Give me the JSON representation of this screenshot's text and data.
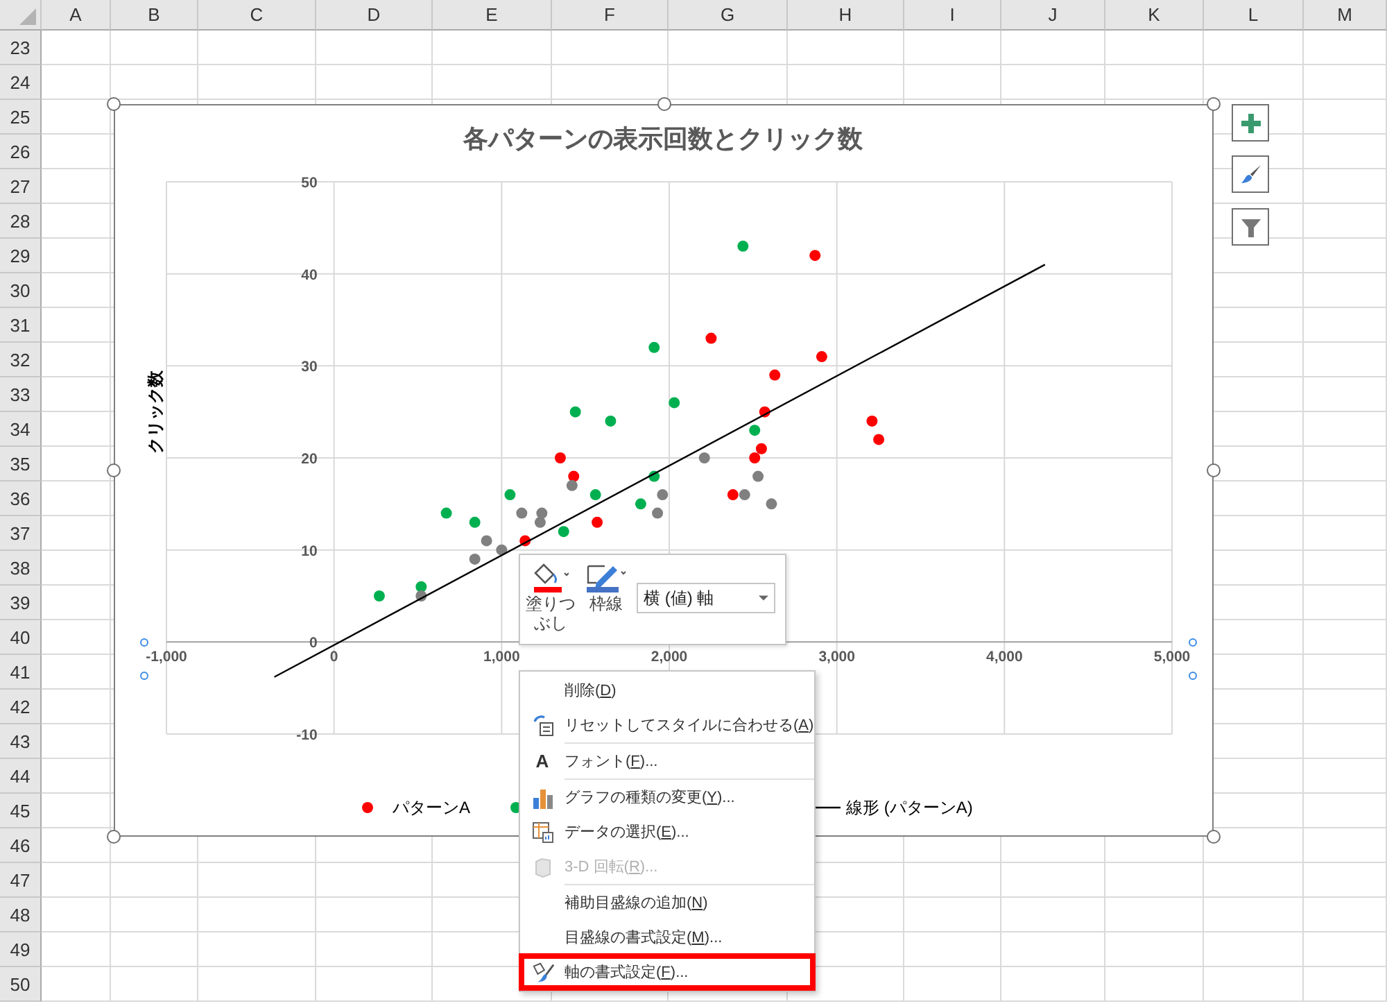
{
  "sheet": {
    "columns": [
      "A",
      "B",
      "C",
      "D",
      "E",
      "F",
      "G",
      "H",
      "I",
      "J",
      "K",
      "L",
      "M"
    ],
    "rows": [
      "23",
      "24",
      "25",
      "26",
      "27",
      "28",
      "29",
      "30",
      "31",
      "32",
      "33",
      "34",
      "35",
      "36",
      "37",
      "38",
      "39",
      "40",
      "41",
      "42",
      "43",
      "44",
      "45",
      "46",
      "47",
      "48",
      "49",
      "50"
    ]
  },
  "chart": {
    "title": "各パターンの表示回数とクリック数",
    "chart_data": {
      "type": "scatter",
      "ylabel": "クリック数",
      "xlim": [
        -1000,
        5000
      ],
      "ylim": [
        -10,
        50
      ],
      "xticks": [
        {
          "value": -1000,
          "label": "-1,000"
        },
        {
          "value": 0,
          "label": "0"
        },
        {
          "value": 1000,
          "label": "1,000"
        },
        {
          "value": 2000,
          "label": "2,000"
        },
        {
          "value": 3000,
          "label": "3,000"
        },
        {
          "value": 4000,
          "label": "4,000"
        },
        {
          "value": 5000,
          "label": "5,000"
        }
      ],
      "yticks": [
        -10,
        0,
        10,
        20,
        30,
        40,
        50
      ],
      "grid": true,
      "legend": true,
      "series": [
        {
          "name": "パターンA",
          "color": "#ff0000",
          "x": [
            1350,
            1430,
            1140,
            1570,
            2870,
            2250,
            2910,
            2630,
            2570,
            3210,
            3250,
            2550,
            2510,
            2380
          ],
          "values": [
            20,
            18,
            11,
            13,
            42,
            33,
            31,
            29,
            25,
            24,
            22,
            21,
            20,
            16
          ]
        },
        {
          "color": "#00b050",
          "x": [
            270,
            520,
            670,
            840,
            1050,
            1370,
            1440,
            1560,
            1650,
            1830,
            1910,
            1910,
            2030,
            2440,
            2510
          ],
          "values": [
            5,
            6,
            14,
            13,
            16,
            12,
            25,
            16,
            24,
            15,
            18,
            32,
            26,
            43,
            23
          ]
        },
        {
          "color": "#808080",
          "x": [
            520,
            840,
            910,
            1000,
            1120,
            1230,
            1240,
            1420,
            1930,
            1960,
            2210,
            2530,
            2450,
            2610
          ],
          "values": [
            5,
            9,
            11,
            10,
            14,
            13,
            14,
            17,
            14,
            16,
            20,
            18,
            16,
            15
          ]
        },
        {
          "name": "線形 (パターンA)",
          "color": "#000000",
          "type": "line",
          "x": [
            -356,
            4242
          ],
          "values": [
            -3.8,
            41
          ]
        }
      ]
    }
  },
  "mini_toolbar": {
    "fill_label": "塗りつぶし",
    "border_label": "枠線",
    "element_dropdown": "横 (値) 軸"
  },
  "context_menu": {
    "items": [
      {
        "before": "削除(",
        "key": "D",
        "after": ")",
        "disabled": false,
        "separator_after": false,
        "marked": false
      },
      {
        "before": "リセットしてスタイルに合わせる(",
        "key": "A",
        "after": ")",
        "disabled": false,
        "separator_after": true,
        "marked": false
      },
      {
        "before": "フォント(",
        "key": "F",
        "after": ")...",
        "icon_text": "A",
        "disabled": false,
        "separator_after": true,
        "marked": false
      },
      {
        "before": "グラフの種類の変更(",
        "key": "Y",
        "after": ")...",
        "disabled": false,
        "separator_after": false,
        "marked": false
      },
      {
        "before": "データの選択(",
        "key": "E",
        "after": ")...",
        "disabled": false,
        "separator_after": false,
        "marked": false
      },
      {
        "before": "3-D 回転(",
        "key": "R",
        "after": ")...",
        "disabled": true,
        "separator_after": true,
        "marked": false
      },
      {
        "before": "補助目盛線の追加(",
        "key": "N",
        "after": ")",
        "disabled": false,
        "separator_after": false,
        "marked": false
      },
      {
        "before": "目盛線の書式設定(",
        "key": "M",
        "after": ")...",
        "disabled": false,
        "separator_after": false,
        "marked": false
      },
      {
        "before": "軸の書式設定(",
        "key": "F",
        "after": ")...",
        "disabled": false,
        "separator_after": false,
        "marked": true
      }
    ]
  }
}
